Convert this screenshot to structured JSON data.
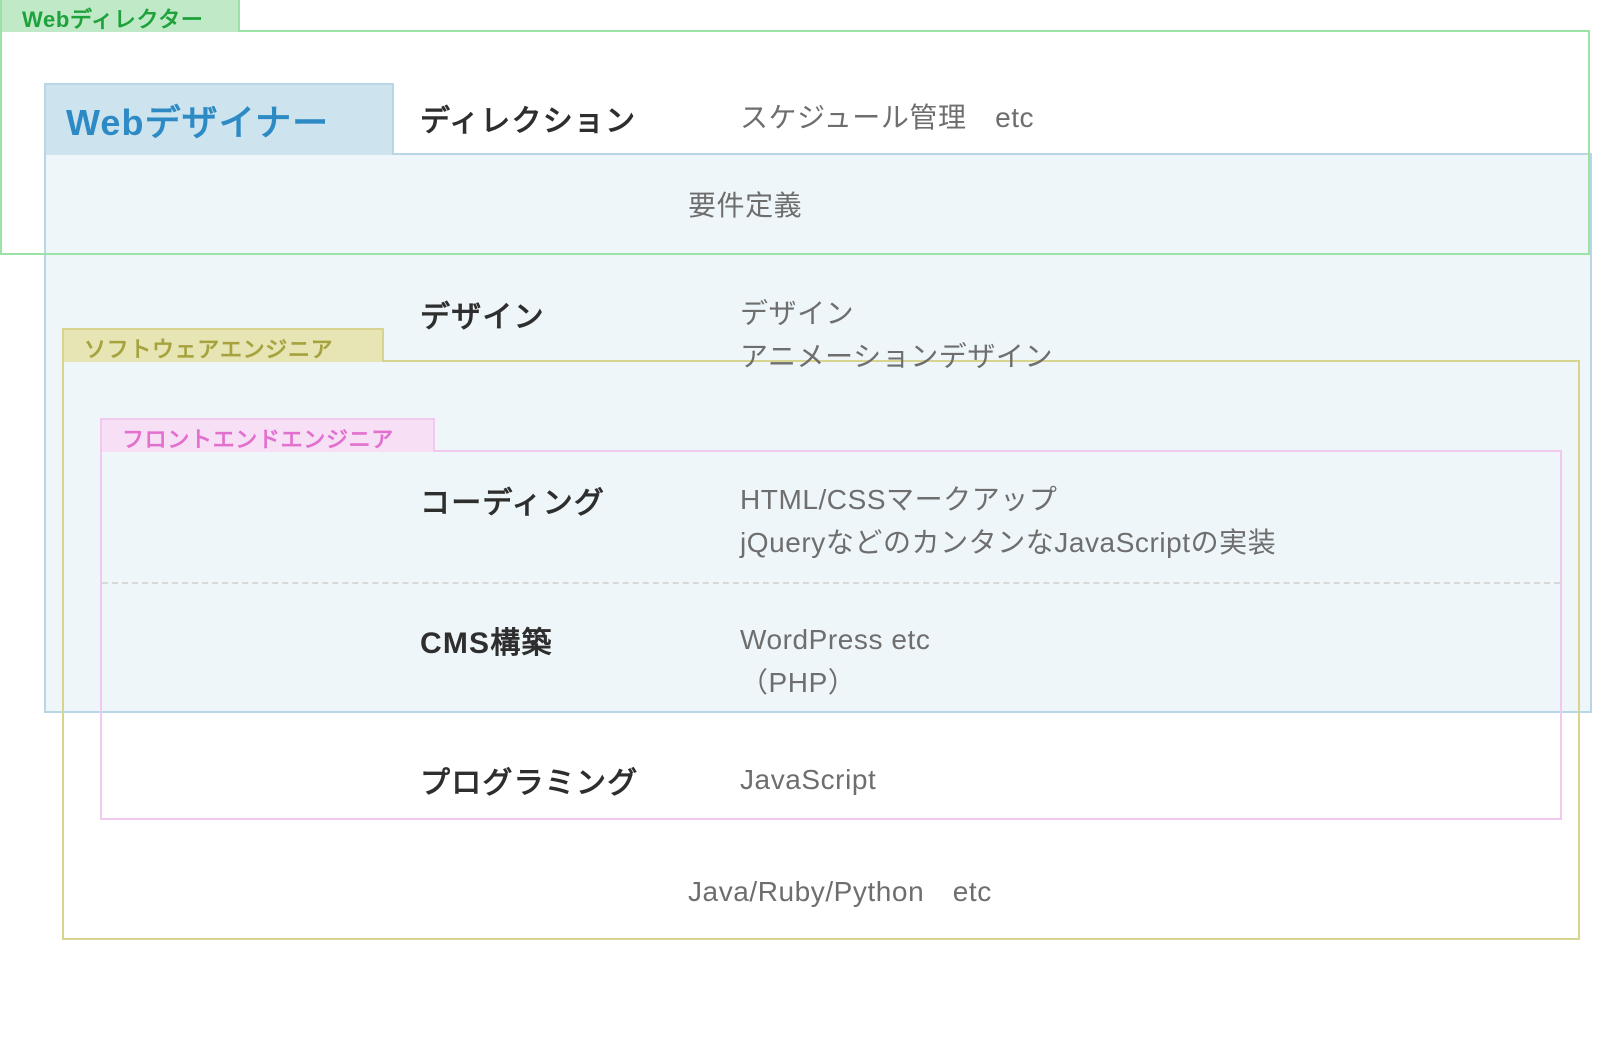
{
  "roles": {
    "director": {
      "label": "Webディレクター",
      "color": "#1fa23c"
    },
    "designer": {
      "label": "Webデザイナー",
      "color": "#2d8ac4"
    },
    "sw_eng": {
      "label": "ソフトウェアエンジニア",
      "color": "#a6a33e"
    },
    "fe_eng": {
      "label": "フロントエンドエンジニア",
      "color": "#e270cf"
    }
  },
  "rows": [
    {
      "category": "ディレクション",
      "lines": [
        "スケジュール管理　etc"
      ]
    },
    {
      "category": "",
      "lines": [
        "要件定義"
      ]
    },
    {
      "category": "デザイン",
      "lines": [
        "デザイン",
        "アニメーションデザイン"
      ]
    },
    {
      "category": "コーディング",
      "lines": [
        "HTML/CSSマークアップ",
        "jQueryなどのカンタンなJavaScriptの実装"
      ]
    },
    {
      "category": "CMS構築",
      "lines": [
        "WordPress etc",
        "（PHP）"
      ]
    },
    {
      "category": "プログラミング",
      "lines": [
        "JavaScript"
      ]
    },
    {
      "category": "",
      "lines": [
        "Java/Ruby/Python　etc"
      ]
    }
  ],
  "chart_data": {
    "type": "diagram",
    "description": "Nested role-scope diagram mapping four web-related job roles to the task categories and concrete skills each role covers.",
    "role_boxes": [
      {
        "id": "director",
        "label": "Webディレクター",
        "covers_rows": [
          0,
          1
        ]
      },
      {
        "id": "designer",
        "label": "Webデザイナー",
        "covers_rows": [
          1,
          2,
          3,
          4
        ]
      },
      {
        "id": "sw_eng",
        "label": "ソフトウェアエンジニア",
        "covers_rows": [
          3,
          4,
          5,
          6
        ]
      },
      {
        "id": "fe_eng",
        "label": "フロントエンドエンジニア",
        "covers_rows": [
          3,
          4,
          5
        ]
      }
    ],
    "task_rows": [
      {
        "index": 0,
        "category": "ディレクション",
        "items": [
          "スケジュール管理　etc"
        ]
      },
      {
        "index": 1,
        "category": "",
        "items": [
          "要件定義"
        ]
      },
      {
        "index": 2,
        "category": "デザイン",
        "items": [
          "デザイン",
          "アニメーションデザイン"
        ]
      },
      {
        "index": 3,
        "category": "コーディング",
        "items": [
          "HTML/CSSマークアップ",
          "jQueryなどのカンタンなJavaScriptの実装"
        ]
      },
      {
        "index": 4,
        "category": "CMS構築",
        "items": [
          "WordPress etc",
          "（PHP）"
        ]
      },
      {
        "index": 5,
        "category": "プログラミング",
        "items": [
          "JavaScript"
        ]
      },
      {
        "index": 6,
        "category": "",
        "items": [
          "Java/Ruby/Python　etc"
        ]
      }
    ]
  }
}
